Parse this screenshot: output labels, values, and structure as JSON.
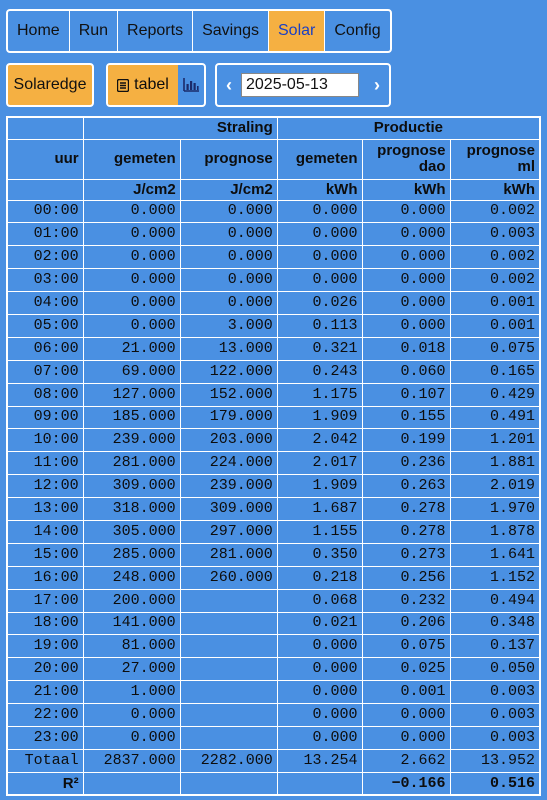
{
  "nav": {
    "items": [
      {
        "label": "Home"
      },
      {
        "label": "Run"
      },
      {
        "label": "Reports"
      },
      {
        "label": "Savings"
      },
      {
        "label": "Solar",
        "active": true
      },
      {
        "label": "Config"
      }
    ]
  },
  "toolbar": {
    "solaredge_label": "Solaredge",
    "tabel_label": "tabel",
    "chart_icon": "bar-chart-icon",
    "table_icon": "table-icon",
    "prev_arrow": "‹",
    "next_arrow": "›",
    "date_value": "2025-05-13"
  },
  "table": {
    "group_headers": {
      "straling": "Straling",
      "productie": "Productie"
    },
    "columns": {
      "uur": "uur",
      "straling_gemeten": "gemeten",
      "straling_prognose": "prognose",
      "prod_gemeten": "gemeten",
      "prod_prognose_dao": "prognose dao",
      "prod_prognose_ml": "prognose ml"
    },
    "units": {
      "straling_gemeten": "J/cm2",
      "straling_prognose": "J/cm2",
      "prod_gemeten": "kWh",
      "prod_prognose_dao": "kWh",
      "prod_prognose_ml": "kWh"
    },
    "rows": [
      [
        "00:00",
        "0.000",
        "0.000",
        "0.000",
        "0.000",
        "0.002"
      ],
      [
        "01:00",
        "0.000",
        "0.000",
        "0.000",
        "0.000",
        "0.003"
      ],
      [
        "02:00",
        "0.000",
        "0.000",
        "0.000",
        "0.000",
        "0.002"
      ],
      [
        "03:00",
        "0.000",
        "0.000",
        "0.000",
        "0.000",
        "0.002"
      ],
      [
        "04:00",
        "0.000",
        "0.000",
        "0.026",
        "0.000",
        "0.001"
      ],
      [
        "05:00",
        "0.000",
        "3.000",
        "0.113",
        "0.000",
        "0.001"
      ],
      [
        "06:00",
        "21.000",
        "13.000",
        "0.321",
        "0.018",
        "0.075"
      ],
      [
        "07:00",
        "69.000",
        "122.000",
        "0.243",
        "0.060",
        "0.165"
      ],
      [
        "08:00",
        "127.000",
        "152.000",
        "1.175",
        "0.107",
        "0.429"
      ],
      [
        "09:00",
        "185.000",
        "179.000",
        "1.909",
        "0.155",
        "0.491"
      ],
      [
        "10:00",
        "239.000",
        "203.000",
        "2.042",
        "0.199",
        "1.201"
      ],
      [
        "11:00",
        "281.000",
        "224.000",
        "2.017",
        "0.236",
        "1.881"
      ],
      [
        "12:00",
        "309.000",
        "239.000",
        "1.909",
        "0.263",
        "2.019"
      ],
      [
        "13:00",
        "318.000",
        "309.000",
        "1.687",
        "0.278",
        "1.970"
      ],
      [
        "14:00",
        "305.000",
        "297.000",
        "1.155",
        "0.278",
        "1.878"
      ],
      [
        "15:00",
        "285.000",
        "281.000",
        "0.350",
        "0.273",
        "1.641"
      ],
      [
        "16:00",
        "248.000",
        "260.000",
        "0.218",
        "0.256",
        "1.152"
      ],
      [
        "17:00",
        "200.000",
        "",
        "0.068",
        "0.232",
        "0.494"
      ],
      [
        "18:00",
        "141.000",
        "",
        "0.021",
        "0.206",
        "0.348"
      ],
      [
        "19:00",
        "81.000",
        "",
        "0.000",
        "0.075",
        "0.137"
      ],
      [
        "20:00",
        "27.000",
        "",
        "0.000",
        "0.025",
        "0.050"
      ],
      [
        "21:00",
        "1.000",
        "",
        "0.000",
        "0.001",
        "0.003"
      ],
      [
        "22:00",
        "0.000",
        "",
        "0.000",
        "0.000",
        "0.003"
      ],
      [
        "23:00",
        "0.000",
        "",
        "0.000",
        "0.000",
        "0.003"
      ]
    ],
    "totaal": [
      "Totaal",
      "2837.000",
      "2282.000",
      "13.254",
      "2.662",
      "13.952"
    ],
    "r2": [
      "R²",
      "",
      "",
      "",
      "−0.166",
      "0.516"
    ]
  }
}
